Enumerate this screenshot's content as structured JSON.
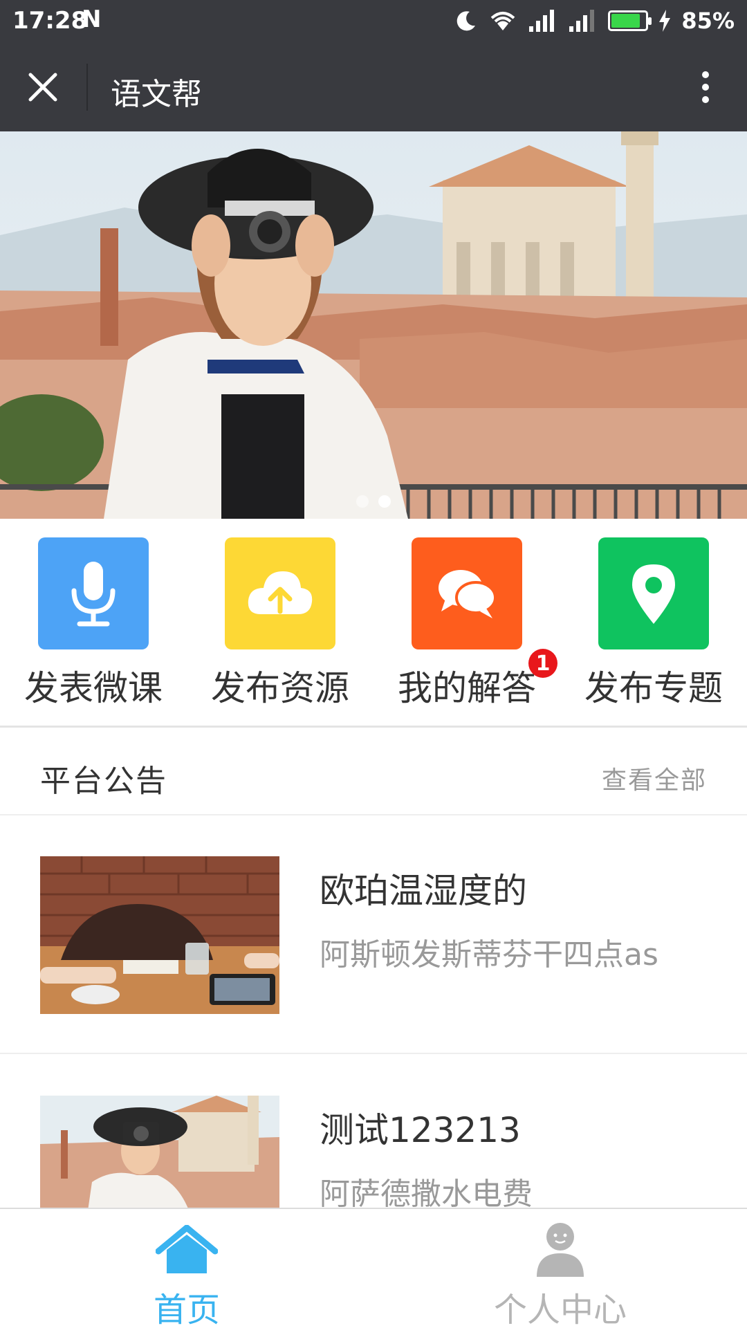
{
  "status_bar": {
    "time": "17:28",
    "carrier_icon": "N",
    "battery_percent": "85%",
    "battery_level": 0.85
  },
  "title_bar": {
    "title": "语文帮"
  },
  "banner": {
    "slide_count": 2,
    "active_slide": 2
  },
  "quick_actions": [
    {
      "label": "发表微课",
      "icon": "microphone-icon",
      "color": "#4da3f6"
    },
    {
      "label": "发布资源",
      "icon": "cloud-upload-icon",
      "color": "#fdd835"
    },
    {
      "label": "我的解答",
      "icon": "chat-bubbles-icon",
      "color": "#fe5d1d",
      "badge": "1"
    },
    {
      "label": "发布专题",
      "icon": "location-pin-icon",
      "color": "#0fc35f"
    }
  ],
  "notice": {
    "title": "平台公告",
    "view_all": "查看全部"
  },
  "articles": [
    {
      "title": "欧珀温湿度的",
      "desc": "阿斯顿发斯蒂芬干四点as"
    },
    {
      "title": "测试123213",
      "desc": "阿萨德撒水电费"
    }
  ],
  "tab_bar": {
    "tabs": [
      {
        "label": "首页",
        "icon": "home-icon",
        "active": true
      },
      {
        "label": "个人中心",
        "icon": "user-icon",
        "active": false
      }
    ],
    "active_color": "#39b3f0",
    "inactive_color": "#b5b5b5"
  }
}
